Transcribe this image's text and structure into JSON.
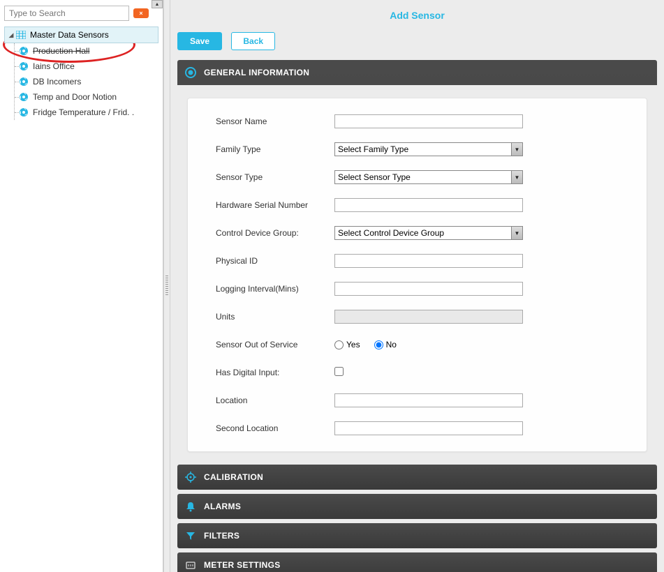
{
  "sidebar": {
    "search_placeholder": "Type to Search",
    "root_label": "Master Data Sensors",
    "items": [
      {
        "label": "Production Hall",
        "struck": true
      },
      {
        "label": "Iains Office",
        "struck": false
      },
      {
        "label": "DB Incomers",
        "struck": false
      },
      {
        "label": "Temp and Door Notion",
        "struck": false
      },
      {
        "label": "Fridge Temperature / Frid. .",
        "struck": false
      }
    ]
  },
  "page_title": "Add Sensor",
  "actions": {
    "save": "Save",
    "back": "Back"
  },
  "panels": {
    "general": {
      "title": "GENERAL INFORMATION",
      "fields": {
        "sensor_name_label": "Sensor Name",
        "sensor_name_value": "",
        "family_type_label": "Family Type",
        "family_type_value": "Select Family Type",
        "sensor_type_label": "Sensor Type",
        "sensor_type_value": "Select Sensor Type",
        "hardware_serial_label": "Hardware Serial Number",
        "hardware_serial_value": "",
        "control_device_group_label": "Control Device Group:",
        "control_device_group_value": "Select Control Device Group",
        "physical_id_label": "Physical ID",
        "physical_id_value": "",
        "logging_interval_label": "Logging Interval(Mins)",
        "logging_interval_value": "",
        "units_label": "Units",
        "units_value": "",
        "out_of_service_label": "Sensor Out of Service",
        "out_of_service_yes": "Yes",
        "out_of_service_no": "No",
        "out_of_service_selected": "No",
        "has_digital_input_label": "Has Digital Input:",
        "has_digital_input_checked": false,
        "location_label": "Location",
        "location_value": "",
        "second_location_label": "Second Location",
        "second_location_value": ""
      }
    },
    "calibration_title": "CALIBRATION",
    "alarms_title": "ALARMS",
    "filters_title": "FILTERS",
    "meter_settings_title": "METER SETTINGS"
  },
  "colors": {
    "accent": "#27b7e3",
    "panel_bg": "#3f3f3f"
  }
}
